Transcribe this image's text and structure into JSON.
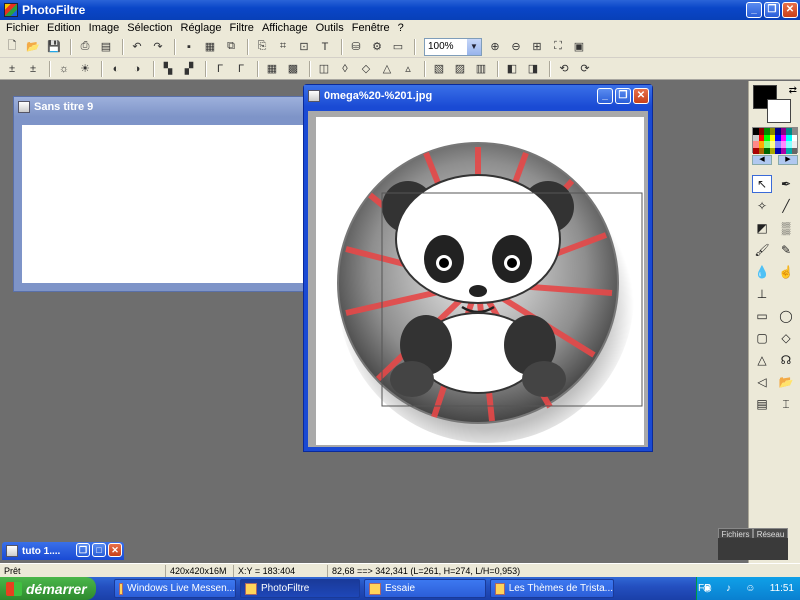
{
  "app": {
    "title": "PhotoFiltre"
  },
  "menu": [
    "Fichier",
    "Edition",
    "Image",
    "Sélection",
    "Réglage",
    "Filtre",
    "Affichage",
    "Outils",
    "Fenêtre",
    "?"
  ],
  "toolbar": {
    "zoom_value": "100%"
  },
  "windows": {
    "untitled": {
      "title": "Sans titre 9"
    },
    "active": {
      "title": "0mega%20-%201.jpg"
    },
    "minimized": {
      "title": "tuto 1...."
    }
  },
  "palette": {
    "tab_files": "Fichiers",
    "tab_network": "Réseau"
  },
  "status": {
    "ready": "Prêt",
    "size": "420x420x16M",
    "coords": "X:Y = 183:404",
    "selection": "82,68 ==> 342,341 (L=261, H=274, L/H=0,953)"
  },
  "taskbar": {
    "start": "démarrer",
    "tasks": [
      "Windows Live Messen...",
      "PhotoFiltre",
      "Essaie",
      "Les Thèmes de Trista..."
    ],
    "lang": "FR",
    "clock": "11:51"
  }
}
